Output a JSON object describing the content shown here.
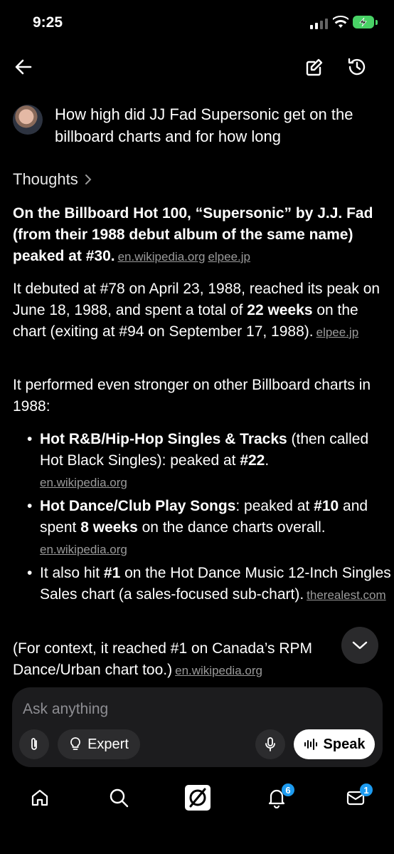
{
  "status_bar": {
    "time": "9:25"
  },
  "question": "How high did JJ Fad Supersonic get on the billboard charts and for how long",
  "thoughts_label": "Thoughts",
  "answer": {
    "p1_bold": "On the Billboard Hot 100, “Supersonic” by J.J. Fad (from their 1988 debut album of the same name) peaked at #30.",
    "p1_src1": "en.wikipedia.org",
    "p1_src2": "elpee.jp",
    "p2_a": "It debuted at #78 on April 23, 1988, reached its peak on June 18, 1988, and spent a total of ",
    "p2_b": "22 weeks",
    "p2_c": " on the chart (exiting at #94 on September 17, 1988).",
    "p2_src": "elpee.jp",
    "p3": "It performed even stronger on other Billboard charts in 1988:",
    "b1_bold": "Hot R&B/Hip-Hop Singles & Tracks",
    "b1_text": " (then called Hot Black Singles): peaked at ",
    "b1_bold2": "#22",
    "b1_end": ".",
    "b1_src": "en.wikipedia.org",
    "b2_bold": "Hot Dance/Club Play Songs",
    "b2_text": ": peaked at ",
    "b2_bold2": "#10",
    "b2_text2": " and spent ",
    "b2_bold3": "8 weeks",
    "b2_end": " on the dance charts overall.",
    "b2_src": "en.wikipedia.org",
    "b3_a": "It also hit ",
    "b3_bold": "#1",
    "b3_b": " on the Hot Dance Music 12-Inch Singles Sales chart (a sales-focused sub-chart).",
    "b3_src": "therealest.com",
    "p4": "(For context, it reached #1 on Canada’s RPM Dance/Urban chart too.)",
    "p4_src": "en.wikipedia.org"
  },
  "composer": {
    "placeholder": "Ask anything",
    "expert_label": "Expert",
    "speak_label": "Speak"
  },
  "tabbar": {
    "notifications_badge": "6",
    "messages_badge": "1"
  },
  "colors": {
    "accent_badge": "#1d9bf0",
    "battery": "#49d266"
  }
}
